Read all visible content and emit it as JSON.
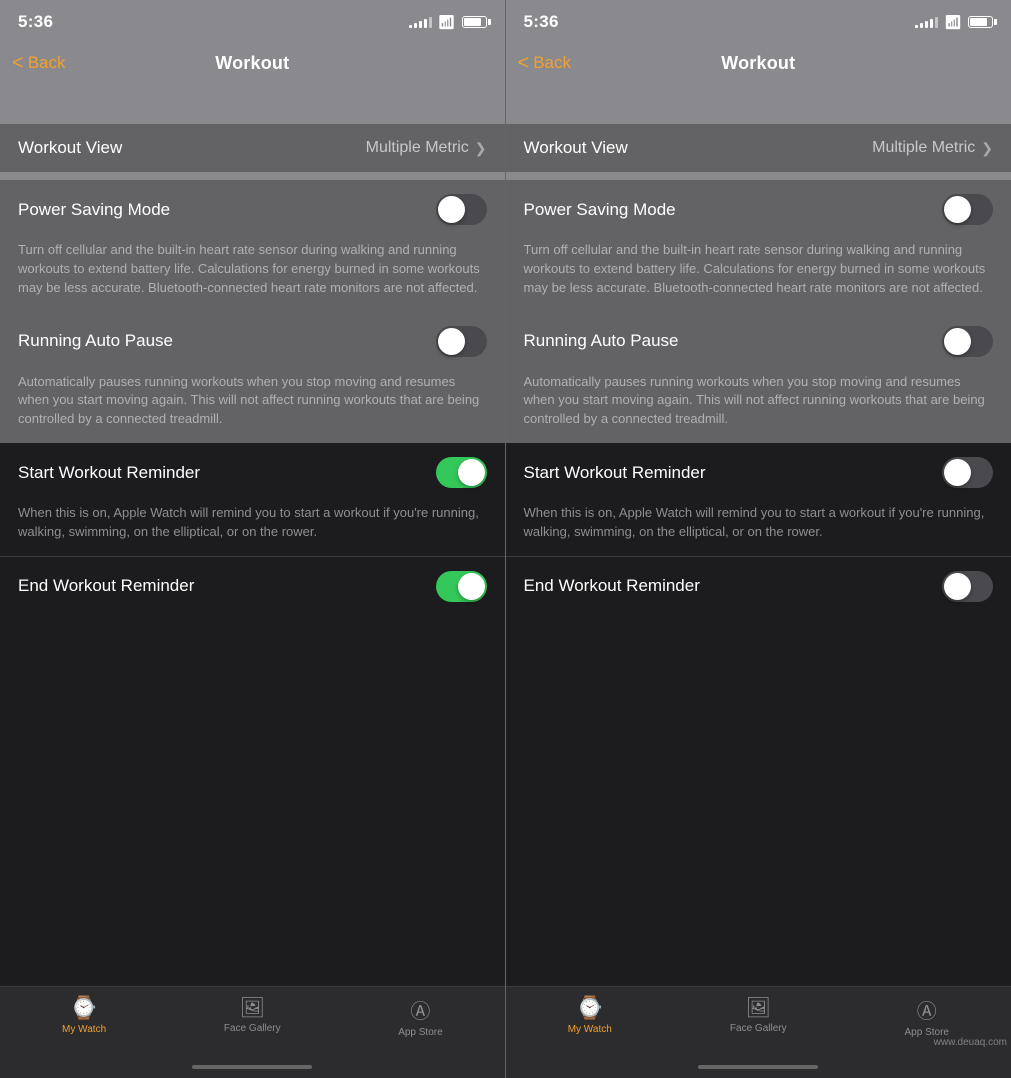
{
  "panels": [
    {
      "id": "left",
      "status": {
        "time": "5:36",
        "signal_bars": [
          3,
          5,
          7,
          9,
          11
        ],
        "wifi": true,
        "battery_pct": 75
      },
      "nav": {
        "back_label": "Back",
        "title": "Workout"
      },
      "sections": {
        "workout_view_label": "Workout View",
        "workout_view_value": "Multiple Metric",
        "power_saving_label": "Power Saving Mode",
        "power_saving_on": false,
        "power_saving_desc": "Turn off cellular and the built-in heart rate sensor during walking and running workouts to extend battery life. Calculations for energy burned in some workouts may be less accurate. Bluetooth-connected heart rate monitors are not affected.",
        "running_pause_label": "Running Auto Pause",
        "running_pause_on": false,
        "running_pause_desc": "Automatically pauses running workouts when you stop moving and resumes when you start moving again. This will not affect running workouts that are being controlled by a connected treadmill.",
        "start_reminder_label": "Start Workout Reminder",
        "start_reminder_on": true,
        "start_reminder_desc": "When this is on, Apple Watch will remind you to start a workout if you're running, walking, swimming, on the elliptical, or on the rower.",
        "end_reminder_label": "End Workout Reminder",
        "end_reminder_on": true
      },
      "tabs": [
        {
          "icon": "⌚",
          "label": "My Watch",
          "active": true
        },
        {
          "icon": "🖼",
          "label": "Face Gallery",
          "active": false
        },
        {
          "icon": "🅐",
          "label": "App Store",
          "active": false
        }
      ]
    },
    {
      "id": "right",
      "status": {
        "time": "5:36",
        "signal_bars": [
          3,
          5,
          7,
          9,
          11
        ],
        "wifi": true,
        "battery_pct": 75
      },
      "nav": {
        "back_label": "Back",
        "title": "Workout"
      },
      "sections": {
        "workout_view_label": "Workout View",
        "workout_view_value": "Multiple Metric",
        "power_saving_label": "Power Saving Mode",
        "power_saving_on": false,
        "power_saving_desc": "Turn off cellular and the built-in heart rate sensor during walking and running workouts to extend battery life. Calculations for energy burned in some workouts may be less accurate. Bluetooth-connected heart rate monitors are not affected.",
        "running_pause_label": "Running Auto Pause",
        "running_pause_on": false,
        "running_pause_desc": "Automatically pauses running workouts when you stop moving and resumes when you start moving again. This will not affect running workouts that are being controlled by a connected treadmill.",
        "start_reminder_label": "Start Workout Reminder",
        "start_reminder_on": false,
        "start_reminder_desc": "When this is on, Apple Watch will remind you to start a workout if you're running, walking, swimming, on the elliptical, or on the rower.",
        "end_reminder_label": "End Workout Reminder",
        "end_reminder_on": false
      },
      "tabs": [
        {
          "icon": "⌚",
          "label": "My Watch",
          "active": true
        },
        {
          "icon": "🖼",
          "label": "Face Gallery",
          "active": false
        },
        {
          "icon": "🅐",
          "label": "App Store",
          "active": false
        }
      ]
    }
  ],
  "watermark": "www.deuaq.com"
}
